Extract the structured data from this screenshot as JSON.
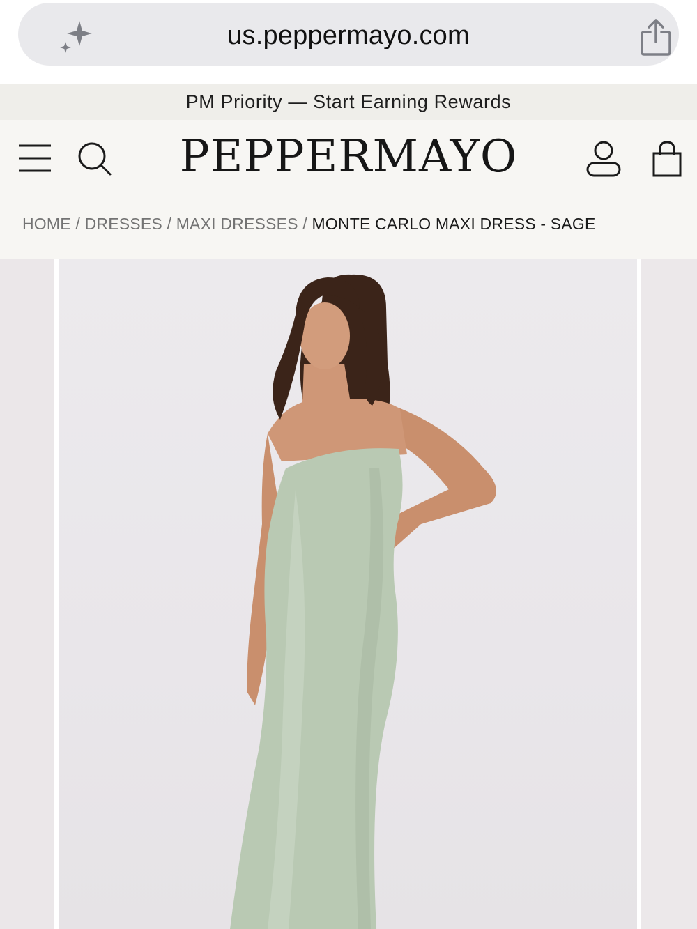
{
  "browser": {
    "url": "us.peppermayo.com",
    "sparkle_icon": "sparkle-icon",
    "share_icon": "share-icon"
  },
  "promo": {
    "text": "PM Priority — Start Earning Rewards"
  },
  "header": {
    "logo": "PEPPERMAYO",
    "icons": [
      "menu-icon",
      "search-icon",
      "account-icon",
      "bag-icon"
    ]
  },
  "breadcrumb": {
    "items": [
      "HOME",
      "DRESSES",
      "MAXI DRESSES"
    ],
    "separator": "/",
    "current": "MONTE CARLO MAXI DRESS - SAGE"
  },
  "gallery": {
    "dress_color": "#b9c9b3",
    "background_color": "#ebe8eb"
  }
}
